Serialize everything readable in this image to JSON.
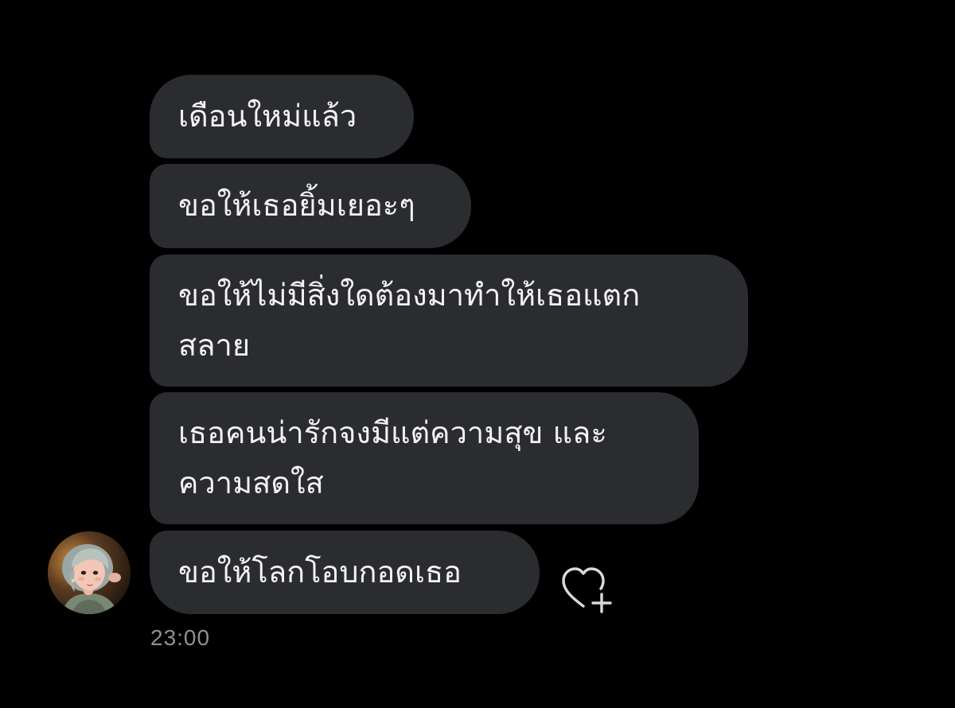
{
  "conversation": {
    "messages": [
      {
        "text": "เดือนใหม่แล้ว"
      },
      {
        "text": "ขอให้เธอยิ้มเยอะๆ"
      },
      {
        "text": "ขอให้ไม่มีสิ่งใดต้องมาทำให้เธอแตก\nสลาย"
      },
      {
        "text": "เธอคนน่ารักจงมีแต่ความสุข และ\nความสดใส"
      },
      {
        "text": "ขอให้โลกโอบกอดเธอ"
      }
    ],
    "timestamp": "23:00",
    "sender_avatar_icon": "avatar-photo",
    "react_icon": "heart-plus-icon"
  },
  "colors": {
    "background": "#000000",
    "bubble": "#2b2c2f",
    "text": "#f2f2f2",
    "meta": "#8e9096"
  }
}
